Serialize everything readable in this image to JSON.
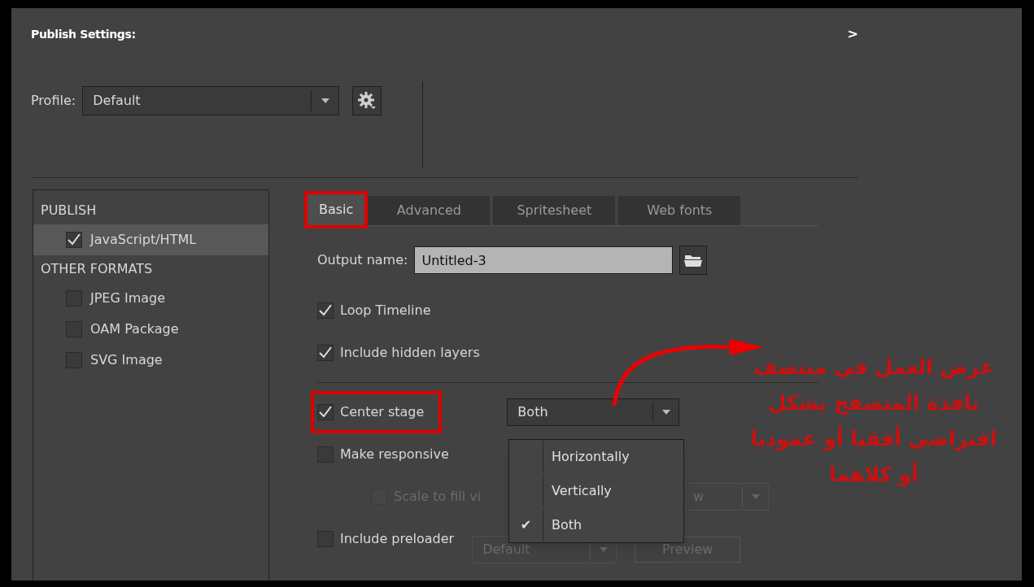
{
  "window": {
    "title": "Publish Settings:",
    "collapse_glyph": ">"
  },
  "profile": {
    "label": "Profile:",
    "value": "Default"
  },
  "sidebar": {
    "sections": [
      {
        "heading": "PUBLISH",
        "items": [
          {
            "label": "JavaScript/HTML",
            "checked": true,
            "selected": true
          }
        ]
      },
      {
        "heading": "OTHER FORMATS",
        "items": [
          {
            "label": "JPEG Image",
            "checked": false,
            "selected": false
          },
          {
            "label": "OAM Package",
            "checked": false,
            "selected": false
          },
          {
            "label": "SVG Image",
            "checked": false,
            "selected": false
          }
        ]
      }
    ]
  },
  "tabs": [
    {
      "label": "Basic",
      "selected": true,
      "highlighted": true
    },
    {
      "label": "Advanced",
      "selected": false,
      "highlighted": false
    },
    {
      "label": "Spritesheet",
      "selected": false,
      "highlighted": false
    },
    {
      "label": "Web fonts",
      "selected": false,
      "highlighted": false
    }
  ],
  "output_name": {
    "label": "Output name:",
    "value": "Untitled-3"
  },
  "options": [
    {
      "kind": "checkbox",
      "label": "Loop Timeline",
      "checked": true,
      "disabled": false,
      "highlighted": false
    },
    {
      "kind": "checkbox",
      "label": "Include hidden layers",
      "checked": true,
      "disabled": false,
      "highlighted": false
    },
    {
      "kind": "divider"
    },
    {
      "kind": "checkbox",
      "label": "Center stage",
      "checked": true,
      "disabled": false,
      "highlighted": true,
      "select": {
        "value": "Both",
        "disabled": false
      }
    },
    {
      "kind": "checkbox",
      "label": "Make responsive",
      "checked": false,
      "disabled": false,
      "highlighted": false
    },
    {
      "kind": "subcheckbox",
      "label": "Scale to fill vi",
      "checked": false,
      "disabled": true,
      "highlighted": false,
      "select": {
        "value": "w",
        "disabled": true
      }
    },
    {
      "kind": "checkbox",
      "label": "Include preloader",
      "checked": false,
      "disabled": false,
      "highlighted": false,
      "select": {
        "value": "Default",
        "disabled": true
      },
      "button": {
        "label": "Preview",
        "disabled": true
      }
    }
  ],
  "dropdown_menu": [
    {
      "label": "Horizontally",
      "selected": false
    },
    {
      "label": "Vertically",
      "selected": false
    },
    {
      "label": "Both",
      "selected": true
    }
  ],
  "check_glyph": "✔",
  "annotation": {
    "text": "عرض العمل في منتصف نافذة المتصفح بشكل افتراضي أفقيا أو عموديا أو كلاهما"
  }
}
